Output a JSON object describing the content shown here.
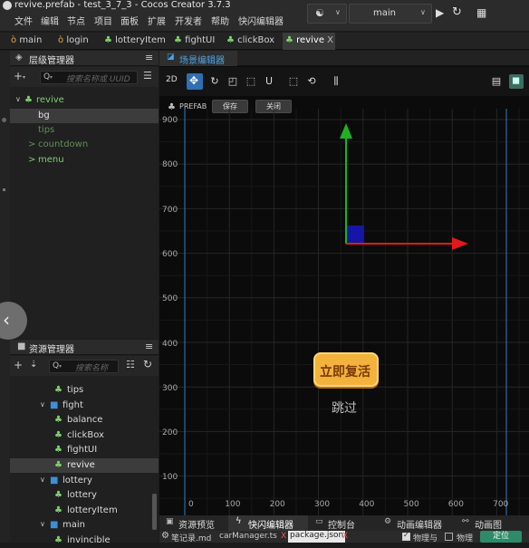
{
  "window": {
    "title": "revive.prefab - test_3_7_3 - Cocos Creator 3.7.3"
  },
  "menu": [
    "文件",
    "编辑",
    "节点",
    "项目",
    "面板",
    "扩展",
    "开发者",
    "帮助",
    "快闪编辑器"
  ],
  "toolbar": {
    "platform": "main"
  },
  "editor_tabs": [
    {
      "label": "main",
      "icon": "scene-icon"
    },
    {
      "label": "login",
      "icon": "scene-icon"
    },
    {
      "label": "lotteryItem",
      "icon": "prefab-icon"
    },
    {
      "label": "fightUI",
      "icon": "prefab-icon"
    },
    {
      "label": "clickBox",
      "icon": "prefab-icon"
    },
    {
      "label": "revive",
      "icon": "prefab-icon",
      "close": "X"
    }
  ],
  "hierarchy": {
    "title": "层级管理器",
    "search_placeholder": "搜索名称或 UUID",
    "nodes": [
      {
        "label": "revive",
        "arrow": "∨",
        "color": "#7ecf6e"
      },
      {
        "label": "bg",
        "arrow": "",
        "color": "#e0e0e0"
      },
      {
        "label": "tips",
        "arrow": "",
        "color": "#5e8f5a"
      },
      {
        "label": "countdown",
        "arrow": ">",
        "color": "#5e8f5a"
      },
      {
        "label": "menu",
        "arrow": ">",
        "color": "#7ecf6e"
      }
    ]
  },
  "assets": {
    "title": "资源管理器",
    "search_placeholder": "搜索名称",
    "items": [
      {
        "label": "tips",
        "type": "prefab",
        "arrow": ""
      },
      {
        "label": "fight",
        "type": "folder",
        "arrow": "∨"
      },
      {
        "label": "balance",
        "type": "prefab",
        "arrow": ""
      },
      {
        "label": "clickBox",
        "type": "prefab",
        "arrow": ""
      },
      {
        "label": "fightUI",
        "type": "prefab",
        "arrow": ""
      },
      {
        "label": "revive",
        "type": "prefab",
        "arrow": ""
      },
      {
        "label": "lottery",
        "type": "folder",
        "arrow": "∨"
      },
      {
        "label": "lottery",
        "type": "prefab",
        "arrow": ""
      },
      {
        "label": "lotteryItem",
        "type": "prefab",
        "arrow": ""
      },
      {
        "label": "main",
        "type": "folder",
        "arrow": "∨"
      },
      {
        "label": "invincible",
        "type": "prefab",
        "arrow": ""
      }
    ]
  },
  "scene": {
    "tab": "场景编辑器",
    "mode": "2D",
    "prefab_label": "PREFAB",
    "save": "保存",
    "close": "关闭",
    "y_ticks": [
      "900",
      "800",
      "700",
      "600",
      "500",
      "400",
      "300",
      "200",
      "100"
    ],
    "x_ticks": [
      "0",
      "100",
      "200",
      "300",
      "400",
      "500",
      "600",
      "700"
    ],
    "revive_button": "立即复活",
    "skip": "跳过"
  },
  "bottom_tabs": [
    "资源预览",
    "快闪编辑器",
    "控制台",
    "动画编辑器",
    "动画图"
  ],
  "status": {
    "files": [
      "笔记录.md",
      "carManager.ts",
      "package.json"
    ],
    "close": "X",
    "checks": [
      "物理与",
      "物理"
    ],
    "locate": "定位"
  },
  "colors": {
    "accent": "#2f7bcc",
    "node_green": "#7ecf6e",
    "axis_x": "#e01a1a",
    "axis_y": "#1db31d",
    "button": "#f3b23c"
  }
}
